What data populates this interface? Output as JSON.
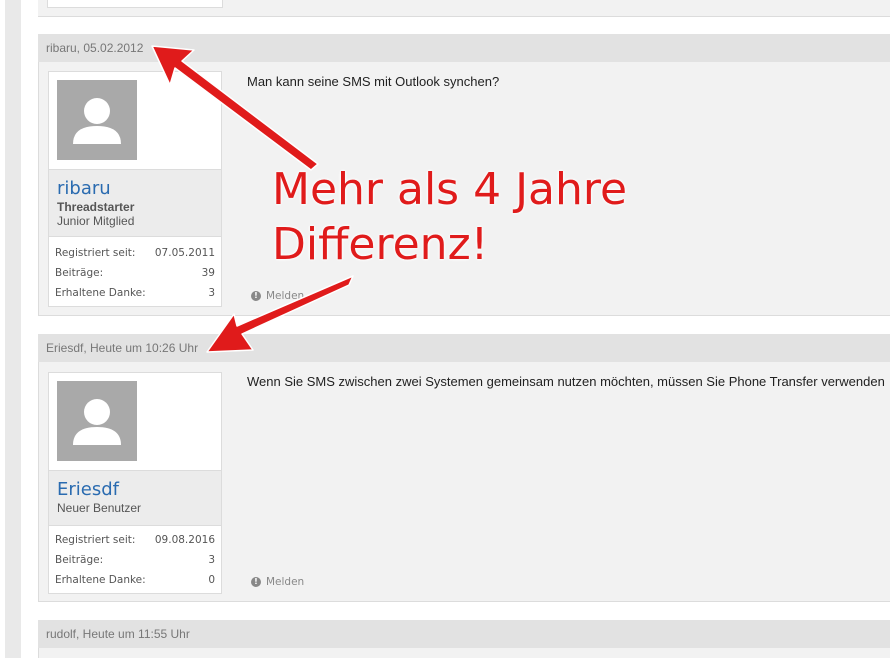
{
  "posts": [
    {
      "header": "ribaru, 05.02.2012",
      "username": "ribaru",
      "role": "Threadstarter",
      "rank": "Junior Mitglied",
      "stats": [
        {
          "label": "Registriert seit:",
          "value": "07.05.2011"
        },
        {
          "label": "Beiträge:",
          "value": "39"
        },
        {
          "label": "Erhaltene Danke:",
          "value": "3"
        }
      ],
      "message": "Man kann seine SMS mit Outlook synchen?",
      "report_label": "Melden"
    },
    {
      "header": "Eriesdf, Heute um 10:26 Uhr",
      "username": "Eriesdf",
      "rank": "Neuer Benutzer",
      "stats": [
        {
          "label": "Registriert seit:",
          "value": "09.08.2016"
        },
        {
          "label": "Beiträge:",
          "value": "3"
        },
        {
          "label": "Erhaltene Danke:",
          "value": "0"
        }
      ],
      "message": "Wenn Sie SMS zwischen zwei Systemen gemeinsam nutzen möchten, müssen Sie Phone Transfer verwenden",
      "report_label": "Melden"
    },
    {
      "header": "rudolf, Heute um 11:55 Uhr"
    }
  ],
  "annotation": {
    "line1": "Mehr als 4 Jahre",
    "line2": "Differenz!",
    "color": "#e01b1b"
  },
  "icons": {
    "avatar": "default-user-silhouette-icon",
    "report": "exclamation-circle-icon"
  }
}
